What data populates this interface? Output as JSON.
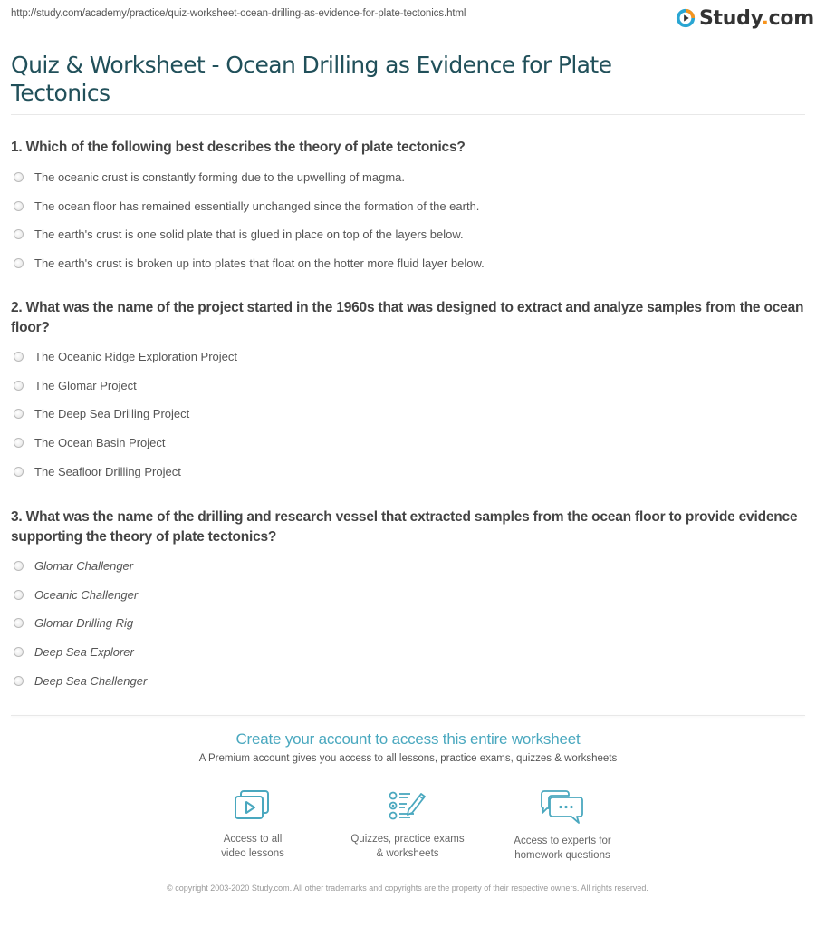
{
  "header": {
    "url": "http://study.com/academy/practice/quiz-worksheet-ocean-drilling-as-evidence-for-plate-tectonics.html",
    "logo_text_main": "Study",
    "logo_text_dot": ".",
    "logo_text_tld": "com",
    "logo_icon": "play-circle-icon"
  },
  "page": {
    "title": "Quiz & Worksheet - Ocean Drilling as Evidence for Plate Tectonics"
  },
  "questions": [
    {
      "text": "1. Which of the following best describes the theory of plate tectonics?",
      "italic": false,
      "options": [
        "The oceanic crust is constantly forming due to the upwelling of magma.",
        "The ocean floor has remained essentially unchanged since the formation of the earth.",
        "The earth's crust is one solid plate that is glued in place on top of the layers below.",
        "The earth's crust is broken up into plates that float on the hotter more fluid layer below."
      ]
    },
    {
      "text": "2. What was the name of the project started in the 1960s that was designed to extract and analyze samples from the ocean floor?",
      "italic": false,
      "options": [
        "The Oceanic Ridge Exploration Project",
        "The Glomar Project",
        "The Deep Sea Drilling Project",
        "The Ocean Basin Project",
        "The Seafloor Drilling Project"
      ]
    },
    {
      "text": "3. What was the name of the drilling and research vessel that extracted samples from the ocean floor to provide evidence supporting the theory of plate tectonics?",
      "italic": true,
      "options": [
        "Glomar Challenger",
        "Oceanic Challenger",
        "Glomar Drilling Rig",
        "Deep Sea Explorer",
        "Deep Sea Challenger"
      ]
    }
  ],
  "cta": {
    "title": "Create your account to access this entire worksheet",
    "subtitle": "A Premium account gives you access to all lessons, practice exams, quizzes & worksheets",
    "features": [
      {
        "icon": "video-lessons-icon",
        "line1": "Access to all",
        "line2": "video lessons"
      },
      {
        "icon": "quiz-checklist-icon",
        "line1": "Quizzes, practice exams",
        "line2": "& worksheets"
      },
      {
        "icon": "chat-bubbles-icon",
        "line1": "Access to experts for",
        "line2": "homework questions"
      }
    ]
  },
  "footer": {
    "copyright": "© copyright 2003-2020 Study.com. All other trademarks and copyrights are the property of their respective owners. All rights reserved."
  },
  "colors": {
    "title": "#21505a",
    "accent": "#4aa8bf",
    "logo_orange": "#f7941d",
    "logo_blue": "#2aa6d3"
  }
}
